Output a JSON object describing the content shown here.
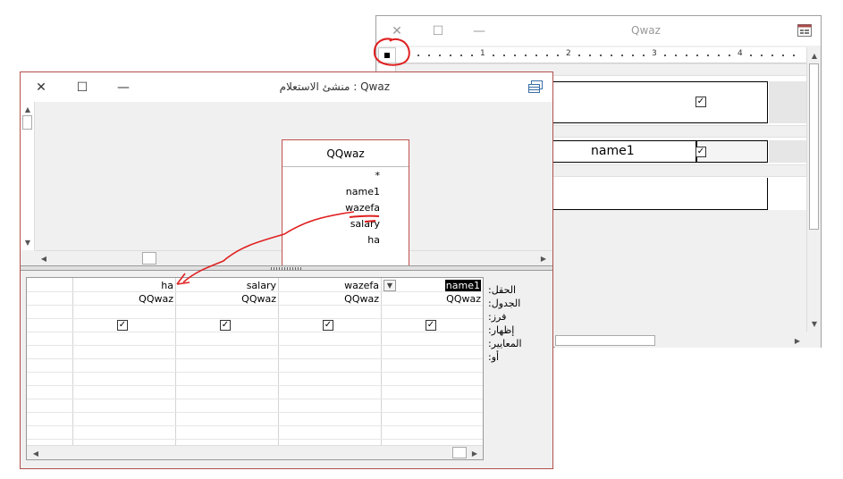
{
  "form_window": {
    "title": "Qwaz",
    "ruler_numbers": [
      "1",
      "2",
      "3",
      "4"
    ],
    "field_text": "name1"
  },
  "query_window": {
    "title": "Qwaz : منشئ الاستعلام",
    "table": {
      "name": "QQwaz",
      "fields": [
        "*",
        "name1",
        "wazefa",
        "salary",
        "ha"
      ]
    },
    "grid": {
      "row_labels": [
        "الحقل:",
        "الجدول:",
        "فرز:",
        "إظهار:",
        "المعايير:",
        "أو:"
      ],
      "columns": [
        {
          "field": "name1",
          "table": "QQwaz",
          "show": true
        },
        {
          "field": "wazefa",
          "table": "QQwaz",
          "show": true
        },
        {
          "field": "salary",
          "table": "QQwaz",
          "show": true
        },
        {
          "field": "ha",
          "table": "QQwaz",
          "show": true
        }
      ]
    }
  },
  "colors": {
    "window_border_accent": "#b0504a",
    "annotation_red": "#e02020",
    "selection": "#000000"
  },
  "icons": [
    "close-icon",
    "maximize-icon",
    "minimize-icon",
    "form-app-icon",
    "query-app-icon",
    "check-icon"
  ]
}
